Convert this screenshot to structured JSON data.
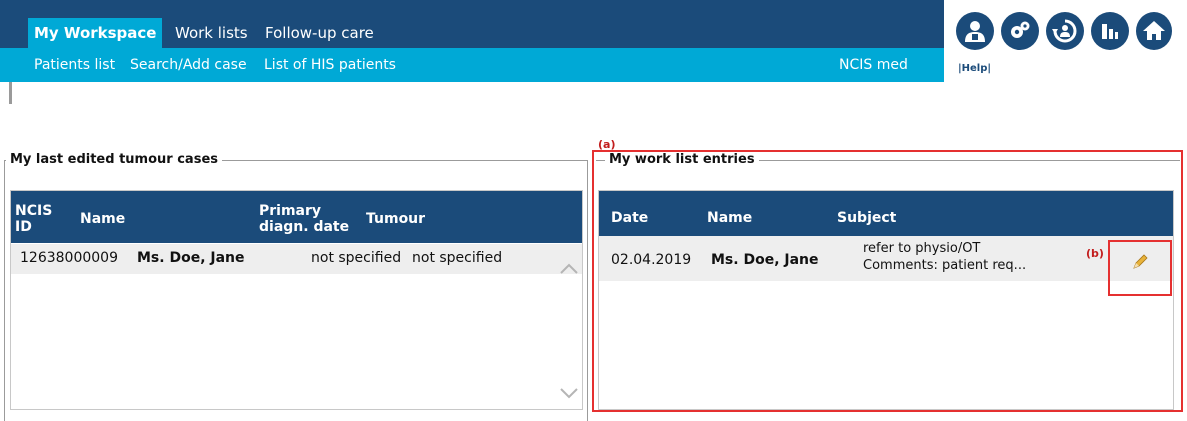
{
  "nav": {
    "tabs": [
      {
        "label": "My Workspace"
      },
      {
        "label": "Work lists"
      },
      {
        "label": "Follow-up care"
      }
    ],
    "sub_links": [
      "Patients list",
      "Search/Add case",
      "List of HIS patients"
    ],
    "app_label": "NCIS med"
  },
  "toolbar": {
    "icons": [
      "user-icon",
      "settings-icon",
      "refresh-user-icon",
      "bar-chart-icon",
      "home-icon"
    ],
    "help_label": "|Help|"
  },
  "last_cases": {
    "legend": "My last edited tumour cases",
    "columns": [
      "NCIS ID",
      "Name",
      "Primary diagn. date",
      "Tumour"
    ],
    "rows": [
      {
        "id": "12638000009",
        "name": "Ms. Doe, Jane",
        "diagn_date": "not specified",
        "tumour": "not specified"
      }
    ]
  },
  "work_list": {
    "legend": "My work list entries",
    "columns": [
      "Date",
      "Name",
      "Subject"
    ],
    "rows": [
      {
        "date": "02.04.2019",
        "name": "Ms. Doe, Jane",
        "subject_line1": "refer to physio/OT",
        "subject_line2": "Comments: patient req..."
      }
    ]
  },
  "annotations": {
    "a": "(a)",
    "b": "(b)"
  },
  "colors": {
    "nav_dark": "#1b4b7a",
    "nav_cyan": "#00a9d6",
    "grid_header": "#1b4b7a",
    "annotation": "#e53030"
  }
}
